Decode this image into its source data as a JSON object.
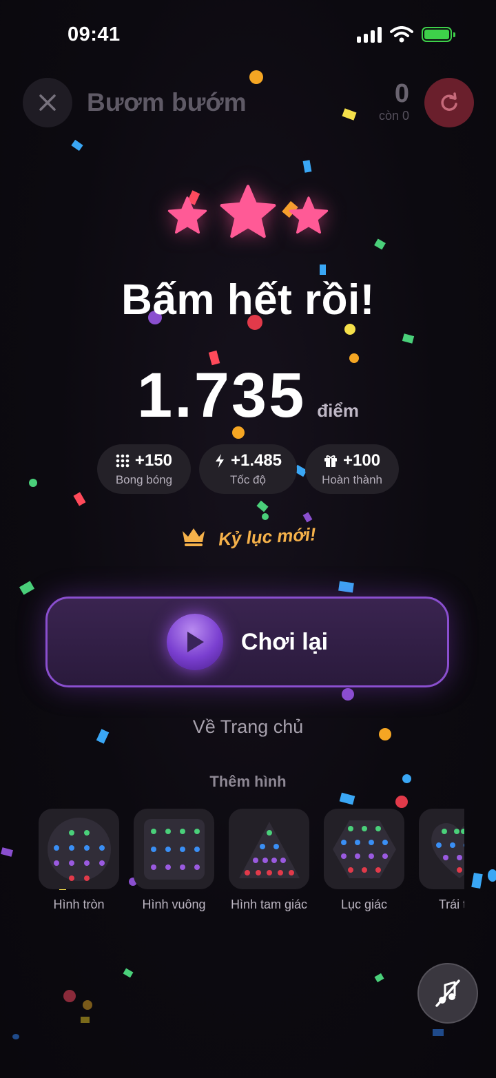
{
  "status_bar": {
    "time": "09:41"
  },
  "header": {
    "title": "Bươm bướm",
    "score": "0",
    "remaining": "còn 0"
  },
  "result": {
    "headline": "Bấm hết rồi!",
    "score": "1.735",
    "score_unit": "điểm",
    "stars_earned": 3,
    "bonuses": [
      {
        "value": "+150",
        "label": "Bong bóng",
        "icon": "grid-dots-icon"
      },
      {
        "value": "+1.485",
        "label": "Tốc độ",
        "icon": "lightning-icon"
      },
      {
        "value": "+100",
        "label": "Hoàn thành",
        "icon": "gift-icon"
      }
    ],
    "record": "Kỷ lục mới!"
  },
  "actions": {
    "replay": "Chơi lại",
    "home": "Về Trang chủ"
  },
  "more_shapes": {
    "title": "Thêm hình",
    "items": [
      {
        "label": "Hình tròn"
      },
      {
        "label": "Hình vuông"
      },
      {
        "label": "Hình tam giác"
      },
      {
        "label": "Lục giác"
      },
      {
        "label": "Trái tim"
      }
    ]
  },
  "colors": {
    "accent": "#8a4fcf",
    "star": "#ff5a96",
    "record": "#f5b14a",
    "restart": "#6a1f2c"
  }
}
